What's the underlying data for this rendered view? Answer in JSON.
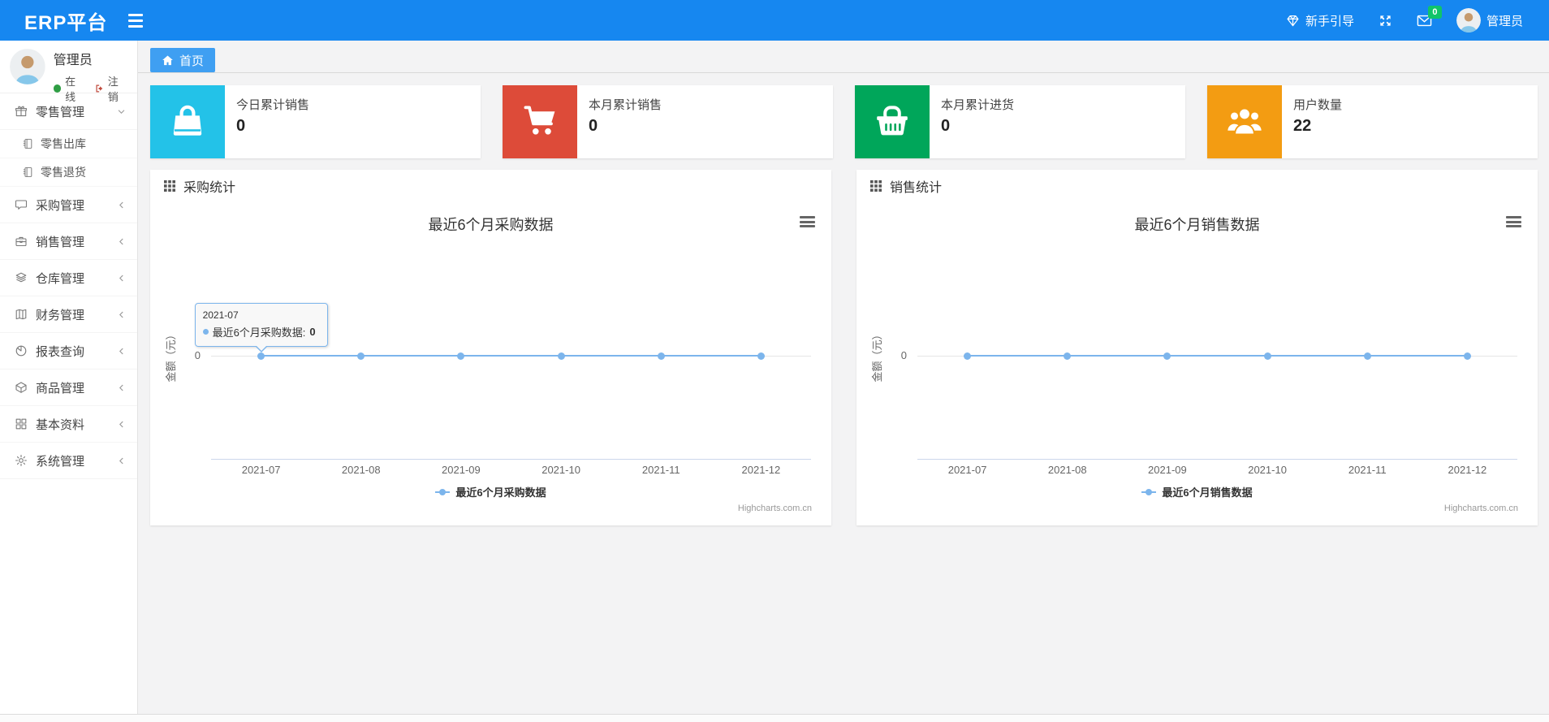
{
  "navbar": {
    "brand": "ERP平台",
    "guide_label": "新手引导",
    "messages_badge": "0",
    "badge_color": "#10c469",
    "user_name": "管理员",
    "icons": {
      "guide": "gem-icon",
      "fullscreen": "arrows-expand-icon",
      "messages": "envelope-icon",
      "menu": "hamburger-icon"
    }
  },
  "sidebar": {
    "user": {
      "name": "管理员",
      "status": "在线",
      "logout": "注销"
    },
    "menu": [
      {
        "label": "零售管理",
        "icon": "gift-icon",
        "expanded": true,
        "children": [
          {
            "label": "零售出库",
            "icon": "journal-icon"
          },
          {
            "label": "零售退货",
            "icon": "journal-icon"
          }
        ]
      },
      {
        "label": "采购管理",
        "icon": "comment-icon"
      },
      {
        "label": "销售管理",
        "icon": "briefcase-icon"
      },
      {
        "label": "仓库管理",
        "icon": "layers-icon"
      },
      {
        "label": "财务管理",
        "icon": "ledger-icon"
      },
      {
        "label": "报表查询",
        "icon": "pie-chart-icon"
      },
      {
        "label": "商品管理",
        "icon": "box-icon"
      },
      {
        "label": "基本资料",
        "icon": "grid-icon"
      },
      {
        "label": "系统管理",
        "icon": "gear-icon"
      }
    ]
  },
  "tabs": {
    "home": "首页",
    "home_icon": "home-icon"
  },
  "stat_cards": [
    {
      "label": "今日累计销售",
      "value": "0",
      "color": "#23c2e8",
      "icon": "shopping-bag-icon"
    },
    {
      "label": "本月累计销售",
      "value": "0",
      "color": "#dd4b39",
      "icon": "cart-icon"
    },
    {
      "label": "本月累计进货",
      "value": "0",
      "color": "#00a65a",
      "icon": "basket-icon"
    },
    {
      "label": "用户数量",
      "value": "22",
      "color": "#f39c12",
      "icon": "users-icon"
    }
  ],
  "panels": [
    {
      "title": "采购统计",
      "icon": "th-grid-icon"
    },
    {
      "title": "销售统计",
      "icon": "th-grid-icon"
    }
  ],
  "chart_data": [
    {
      "type": "line",
      "title": "最近6个月采购数据",
      "categories": [
        "2021-07",
        "2021-08",
        "2021-09",
        "2021-10",
        "2021-11",
        "2021-12"
      ],
      "series": [
        {
          "name": "最近6个月采购数据",
          "values": [
            0,
            0,
            0,
            0,
            0,
            0
          ]
        }
      ],
      "ylabel": "金额（元）",
      "yticks": [
        "0"
      ],
      "ylim": [
        0,
        0
      ],
      "grid": "horizontal-zero-line",
      "line_color": "#7cb5ec",
      "legend_position": "bottom",
      "credits": "Highcharts.com.cn",
      "tooltip": {
        "header": "2021-07",
        "series_name": "最近6个月采购数据",
        "value": "0"
      }
    },
    {
      "type": "line",
      "title": "最近6个月销售数据",
      "categories": [
        "2021-07",
        "2021-08",
        "2021-09",
        "2021-10",
        "2021-11",
        "2021-12"
      ],
      "series": [
        {
          "name": "最近6个月销售数据",
          "values": [
            0,
            0,
            0,
            0,
            0,
            0
          ]
        }
      ],
      "ylabel": "金额（元）",
      "yticks": [
        "0"
      ],
      "ylim": [
        0,
        0
      ],
      "grid": "horizontal-zero-line",
      "line_color": "#7cb5ec",
      "legend_position": "bottom",
      "credits": "Highcharts.com.cn",
      "tooltip": null
    }
  ]
}
